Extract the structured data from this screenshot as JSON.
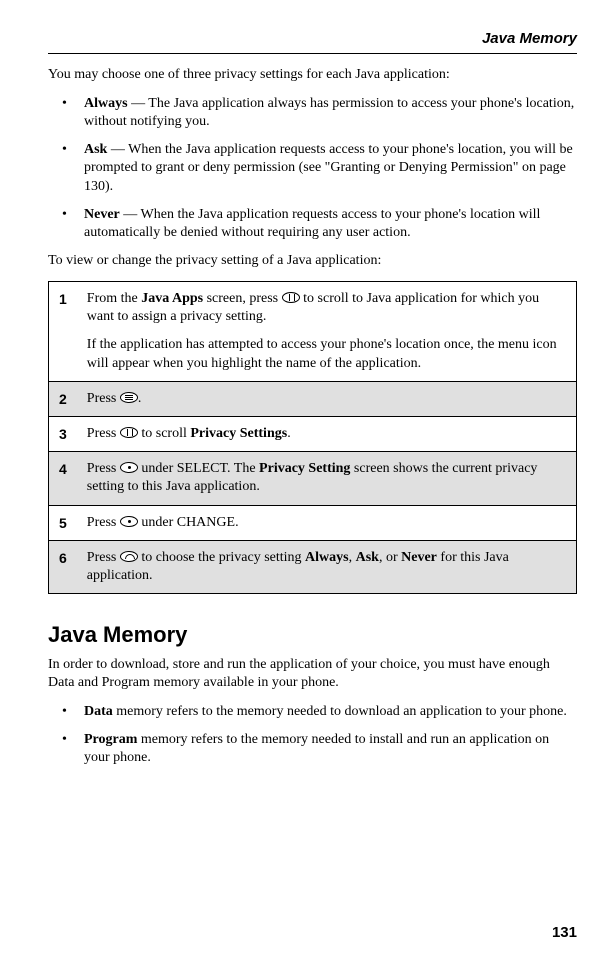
{
  "header_label": "Java Memory",
  "intro": "You may choose one of three privacy settings for each Java application:",
  "privacy_options": [
    {
      "term": "Always",
      "desc": " — The Java application always has permission to access your phone's location, without notifying you."
    },
    {
      "term": "Ask",
      "desc": " — When the Java application requests access to your phone's location, you will be prompted to grant or deny permission (see \"Granting or Denying Permission\" on page 130)."
    },
    {
      "term": "Never",
      "desc": " — When the Java application requests access to your phone's location will automatically be denied without requiring any user action."
    }
  ],
  "view_change_intro": "To view or change the privacy setting of a Java application:",
  "steps": [
    {
      "num": "1",
      "pre": "From the ",
      "bold1": "Java Apps",
      "mid": " screen, press ",
      "icon": "scroll",
      "post": " to scroll to Java application for which you want to assign a privacy setting.",
      "extra": "If the application has attempted to access your phone's location once, the menu icon will appear when you highlight the name of the application."
    },
    {
      "num": "2",
      "pre": "Press ",
      "icon": "menu",
      "post": "."
    },
    {
      "num": "3",
      "pre": "Press ",
      "icon": "scroll",
      "mid": " to scroll ",
      "bold1": "Privacy Settings",
      "post": "."
    },
    {
      "num": "4",
      "pre": "Press ",
      "icon": "dot",
      "mid": " under SELECT. The ",
      "bold1": "Privacy Setting",
      "post": " screen shows the current privacy setting to this Java application."
    },
    {
      "num": "5",
      "pre": "Press ",
      "icon": "dot",
      "post": " under CHANGE."
    },
    {
      "num": "6",
      "pre": "Press ",
      "icon": "arc",
      "mid": " to choose the privacy setting ",
      "bold1": "Always",
      "mid2": ", ",
      "bold2": "Ask",
      "mid3": ", or ",
      "bold3": "Never",
      "post": " for this Java application."
    }
  ],
  "section_heading": "Java Memory",
  "memory_intro": "In order to download, store and run the application of your choice, you must have enough Data and Program memory available in your phone.",
  "memory_items": [
    {
      "term": "Data",
      "desc": " memory refers to the memory needed to download an application to your phone."
    },
    {
      "term": "Program",
      "desc": " memory refers to the memory needed to install and run an application on your phone."
    }
  ],
  "page_number": "131"
}
